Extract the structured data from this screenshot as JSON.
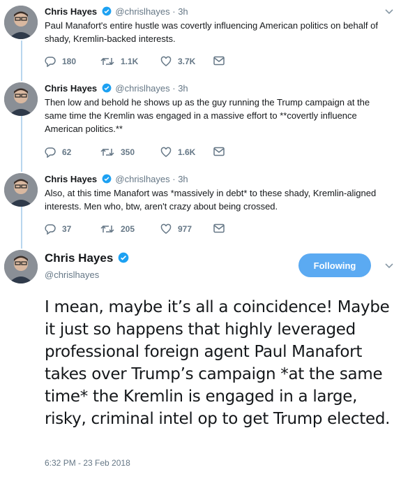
{
  "colors": {
    "accent": "#1da1f2",
    "follow_button": "#5baaf2",
    "thread_line": "#b8d6ee",
    "meta": "#657786"
  },
  "tweets": [
    {
      "name": "Chris Hayes",
      "handle": "@chrislhayes",
      "time": "· 3h",
      "text": "Paul Manafort's entire hustle was covertly influencing American politics on behalf of shady, Kremlin-backed interests.",
      "replies": "180",
      "retweets": "1.1K",
      "likes": "3.7K"
    },
    {
      "name": "Chris Hayes",
      "handle": "@chrislhayes",
      "time": "· 3h",
      "text": "Then low and behold he shows up as the guy running the Trump campaign at the same time the Kremlin was engaged in a massive effort to **covertly influence American politics.**",
      "replies": "62",
      "retweets": "350",
      "likes": "1.6K"
    },
    {
      "name": "Chris Hayes",
      "handle": "@chrislhayes",
      "time": "· 3h",
      "text": "Also, at this time Manafort was *massively in debt* to these shady, Kremlin-aligned interests.  Men who, btw, aren't crazy about being crossed.",
      "replies": "37",
      "retweets": "205",
      "likes": "977"
    }
  ],
  "main_tweet": {
    "name": "Chris Hayes",
    "handle": "@chrislhayes",
    "follow_label": "Following",
    "text": "I mean, maybe it’s all a coincidence! Maybe it just so happens that highly leveraged professional foreign agent Paul Manafort takes over Trump’s campaign *at the same time* the Kremlin is engaged in a large, risky, criminal intel op to get Trump elected.",
    "timestamp": "6:32 PM - 23 Feb 2018"
  },
  "icons": [
    "avatar",
    "verified-badge-icon",
    "chevron-down-icon",
    "reply-icon",
    "retweet-icon",
    "like-icon",
    "message-icon"
  ]
}
